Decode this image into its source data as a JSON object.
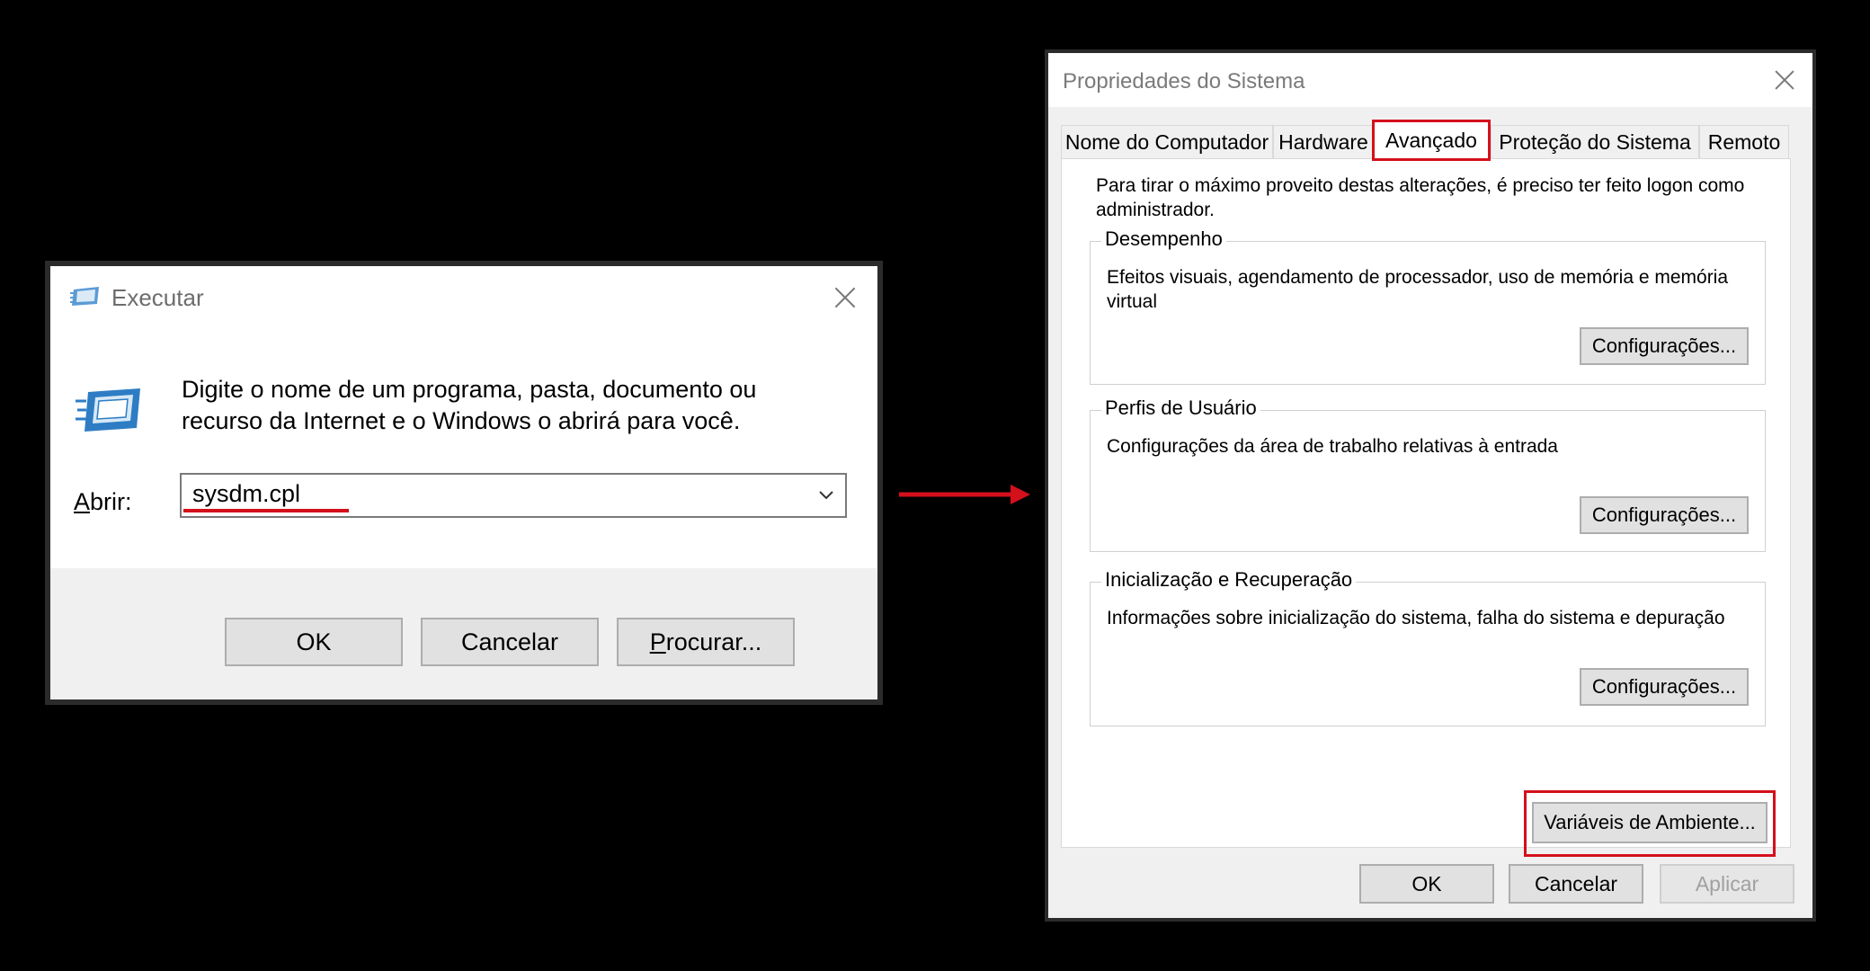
{
  "run_dialog": {
    "title": "Executar",
    "description": "Digite o nome de um programa, pasta, documento ou recurso da Internet e o Windows o abrirá para você.",
    "open_label_access": "A",
    "open_label_rest": "brir:",
    "input_value": "sysdm.cpl",
    "buttons": {
      "ok": "OK",
      "cancel": "Cancelar",
      "browse_access": "P",
      "browse_rest": "rocurar..."
    }
  },
  "system_properties": {
    "title": "Propriedades do Sistema",
    "tabs": [
      {
        "label": "Nome do Computador"
      },
      {
        "label": "Hardware"
      },
      {
        "label": "Avançado",
        "active": true
      },
      {
        "label": "Proteção do Sistema"
      },
      {
        "label": "Remoto"
      }
    ],
    "admin_note": "Para tirar o máximo proveito destas alterações, é preciso ter feito logon como administrador.",
    "groups": [
      {
        "title": "Desempenho",
        "text": "Efeitos visuais, agendamento de processador, uso de memória e memória virtual",
        "button": "Configurações..."
      },
      {
        "title": "Perfis de Usuário",
        "text": "Configurações da área de trabalho relativas à entrada",
        "button": "Configurações..."
      },
      {
        "title": "Inicialização e Recuperação",
        "text": "Informações sobre inicialização do sistema, falha do sistema e depuração",
        "button": "Configurações..."
      }
    ],
    "env_button": "Variáveis de Ambiente...",
    "footer": {
      "ok": "OK",
      "cancel": "Cancelar",
      "apply": "Aplicar"
    }
  },
  "colors": {
    "highlight": "#d4101b",
    "background": "#000000"
  }
}
